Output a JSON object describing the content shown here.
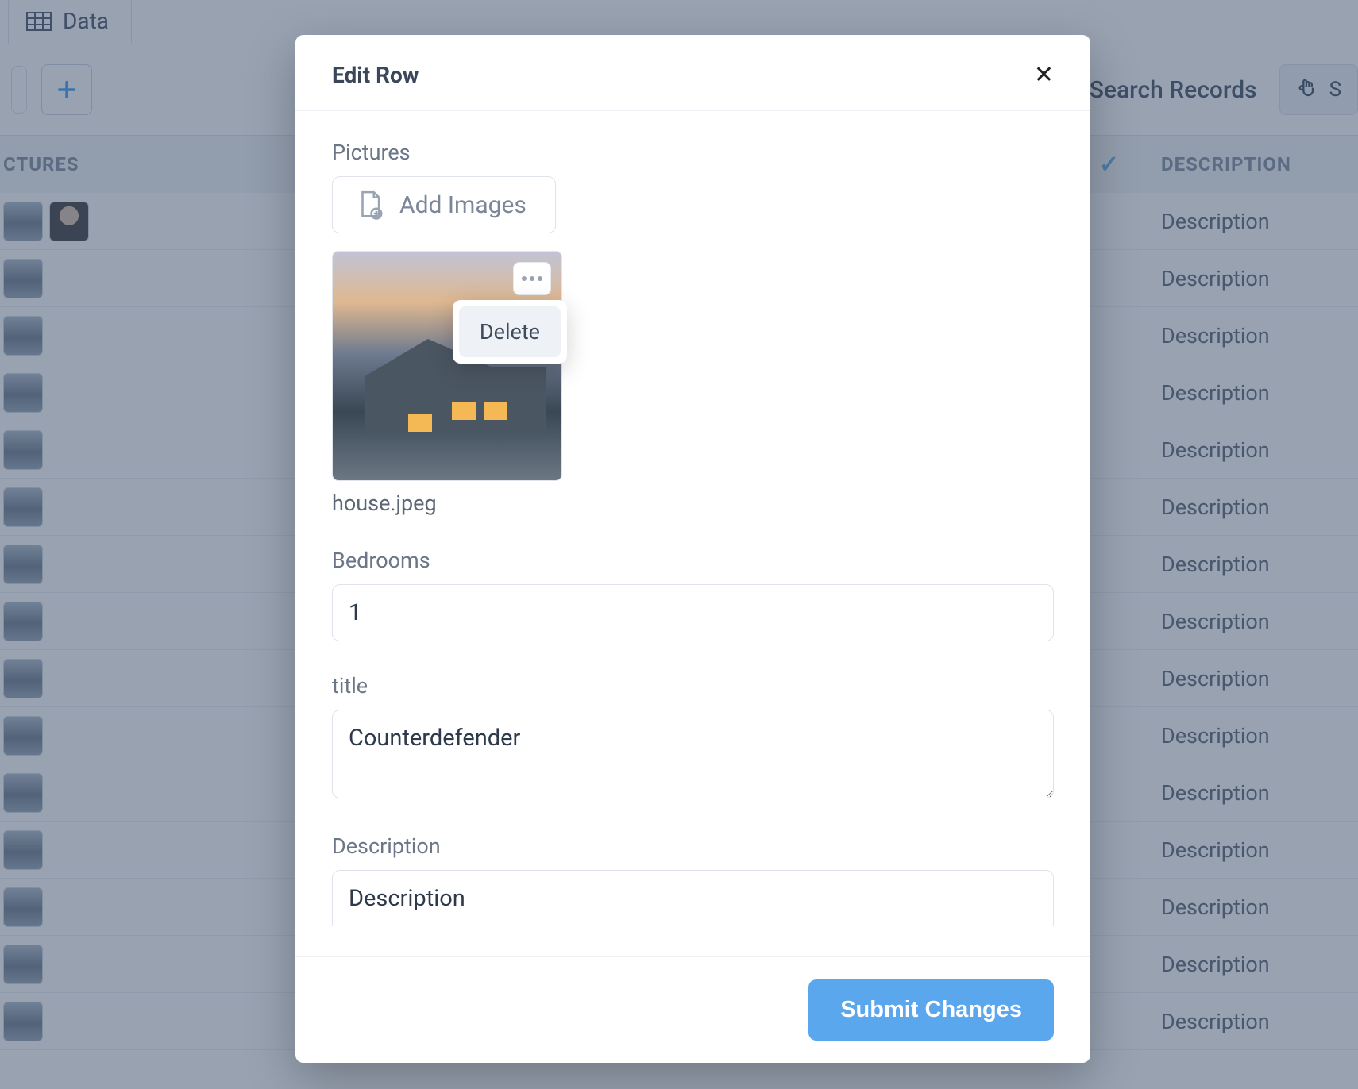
{
  "tab": {
    "label": "Data"
  },
  "toolbar": {
    "search_label": "Search Records",
    "select_prefix": "S"
  },
  "table": {
    "col_pictures": "CTURES",
    "col_description": "DESCRIPTION",
    "rows": [
      {
        "desc": "Description",
        "thumbs": 2
      },
      {
        "desc": "Description",
        "thumbs": 1
      },
      {
        "desc": "Description",
        "thumbs": 1
      },
      {
        "desc": "Description",
        "thumbs": 1
      },
      {
        "desc": "Description",
        "thumbs": 1
      },
      {
        "desc": "Description",
        "thumbs": 1
      },
      {
        "desc": "Description",
        "thumbs": 1
      },
      {
        "desc": "Description",
        "thumbs": 1
      },
      {
        "desc": "Description",
        "thumbs": 1
      },
      {
        "desc": "Description",
        "thumbs": 1
      },
      {
        "desc": "Description",
        "thumbs": 1
      },
      {
        "desc": "Description",
        "thumbs": 1
      },
      {
        "desc": "Description",
        "thumbs": 1
      },
      {
        "desc": "Description",
        "thumbs": 1
      },
      {
        "desc": "Description",
        "thumbs": 1
      }
    ]
  },
  "modal": {
    "title": "Edit Row",
    "fields": {
      "pictures_label": "Pictures",
      "add_images_label": "Add Images",
      "image_filename": "house.jpeg",
      "image_menu_delete": "Delete",
      "bedrooms_label": "Bedrooms",
      "bedrooms_value": "1",
      "title_label": "title",
      "title_value": "Counterdefender",
      "description_label": "Description",
      "description_value": "Description"
    },
    "submit_label": "Submit Changes"
  }
}
